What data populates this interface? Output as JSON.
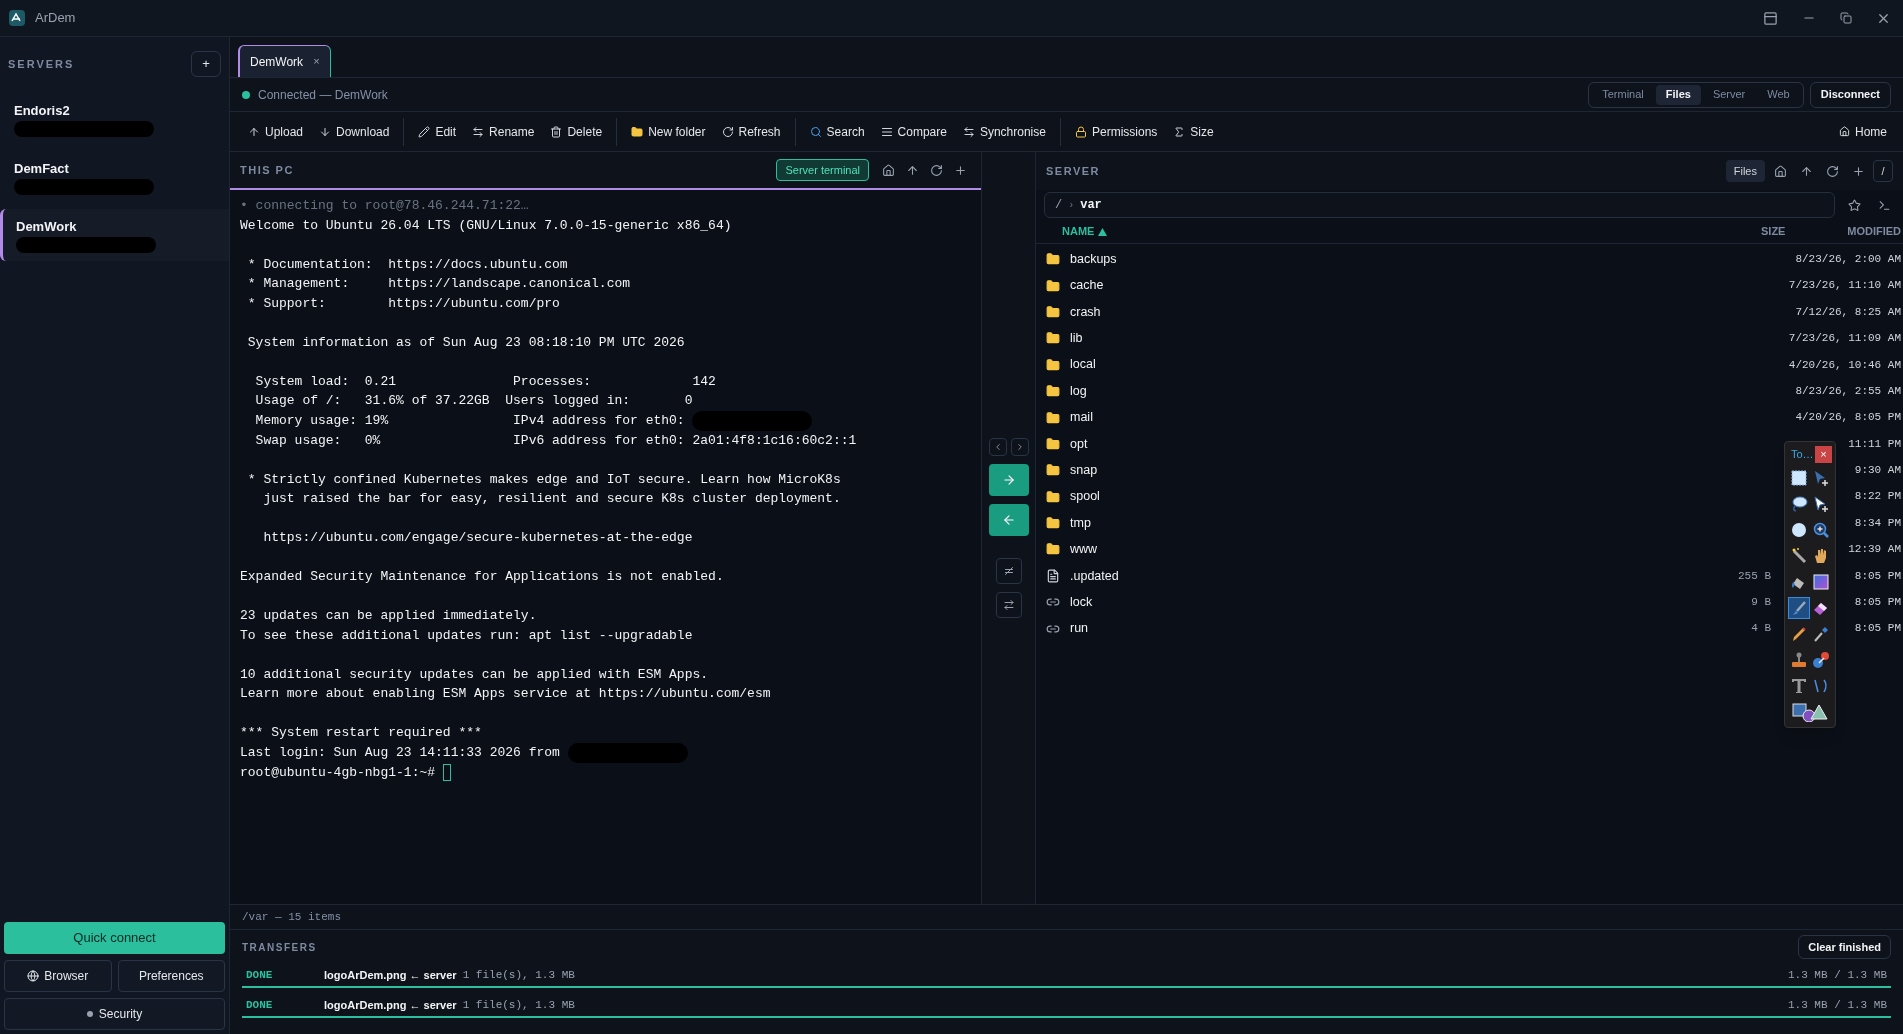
{
  "window": {
    "title": "ArDem"
  },
  "sidebar": {
    "heading": "SERVERS",
    "add": "+",
    "servers": [
      {
        "name": "Endoris2",
        "selected": false,
        "address_redacted": true
      },
      {
        "name": "DemFact",
        "selected": false,
        "address_redacted": true
      },
      {
        "name": "DemWork",
        "selected": true,
        "address_redacted": true
      }
    ],
    "quick_connect": "Quick connect",
    "browser": "Browser",
    "preferences": "Preferences",
    "security": "Security"
  },
  "tabs": [
    {
      "label": "DemWork",
      "close": "×",
      "selected": true
    }
  ],
  "connection": {
    "status": "Connected — DemWork",
    "connected": true
  },
  "views": [
    {
      "label": "Terminal",
      "selected": false
    },
    {
      "label": "Files",
      "selected": true
    },
    {
      "label": "Server",
      "selected": false
    },
    {
      "label": "Web",
      "selected": false
    }
  ],
  "disconnect": "Disconnect",
  "toolbar": {
    "groups": [
      [
        {
          "kind": "upload",
          "label": "Upload"
        },
        {
          "kind": "download",
          "label": "Download"
        }
      ],
      [
        {
          "kind": "edit",
          "label": "Edit"
        },
        {
          "kind": "rename",
          "label": "Rename"
        },
        {
          "kind": "delete",
          "label": "Delete"
        }
      ],
      [
        {
          "kind": "newfolder",
          "label": "New folder"
        },
        {
          "kind": "refresh",
          "label": "Refresh"
        }
      ],
      [
        {
          "kind": "search",
          "label": "Search"
        },
        {
          "kind": "compare",
          "label": "Compare"
        },
        {
          "kind": "sync",
          "label": "Synchronise"
        }
      ],
      [
        {
          "kind": "permissions",
          "label": "Permissions"
        },
        {
          "kind": "size",
          "label": "Size"
        }
      ]
    ],
    "home": "Home"
  },
  "local": {
    "heading": "THIS PC",
    "terminal_button": "Server terminal",
    "terminal": {
      "connecting": "• connecting to root@78.46.244.71:22…",
      "blocks": [
        [
          {
            "text": "Welcome to Ubuntu 26.04 LTS (GNU/Linux 7.0.0-15-generic x86_64)"
          }
        ],
        [
          {
            "text": " * Documentation:  https://docs.ubuntu.com"
          },
          {
            "text": " * Management:     https://landscape.canonical.com"
          },
          {
            "text": " * Support:        https://ubuntu.com/pro"
          }
        ],
        [
          {
            "text": " System information as of Sun Aug 23 08:18:10 PM UTC 2026"
          }
        ],
        [
          {
            "text": "  System load:  0.21               Processes:             142"
          },
          {
            "text": "  Usage of /:   31.6% of 37.22GB  Users logged in:       0"
          },
          {
            "text": "  Memory usage: 19%                IPv4 address for eth0: ",
            "redacted": true
          },
          {
            "text": "  Swap usage:   0%                 IPv6 address for eth0: 2a01:4f8:1c16:60c2::1"
          }
        ],
        [
          {
            "text": " * Strictly confined Kubernetes makes edge and IoT secure. Learn how MicroK8s"
          },
          {
            "text": "   just raised the bar for easy, resilient and secure K8s cluster deployment."
          }
        ],
        [
          {
            "text": "   https://ubuntu.com/engage/secure-kubernetes-at-the-edge"
          }
        ],
        [
          {
            "text": "Expanded Security Maintenance for Applications is not enabled."
          }
        ],
        [
          {
            "text": "23 updates can be applied immediately."
          },
          {
            "text": "To see these additional updates run: apt list --upgradable"
          }
        ],
        [
          {
            "text": "10 additional security updates can be applied with ESM Apps."
          },
          {
            "text": "Learn more about enabling ESM Apps service at https://ubuntu.com/esm"
          }
        ],
        [
          {
            "text": "*** System restart required ***"
          },
          {
            "text": "Last login: Sun Aug 23 14:11:33 2026 from ",
            "redacted": true
          },
          {
            "text": "root@ubuntu-4gb-nbg1-1:~# ",
            "cursor": true
          }
        ]
      ]
    }
  },
  "remote": {
    "heading": "SERVER",
    "files_button": "Files",
    "root_button": "/",
    "path": {
      "root": "/",
      "separator": "›",
      "current": "var"
    },
    "columns": {
      "name": "NAME",
      "size": "SIZE",
      "modified": "MODIFIED"
    },
    "rows": [
      {
        "name": "backups",
        "kind": "folder",
        "modified": "8/23/26, 2:00 AM"
      },
      {
        "name": "cache",
        "kind": "folder",
        "modified": "7/23/26, 11:10 AM"
      },
      {
        "name": "crash",
        "kind": "folder",
        "modified": "7/12/26, 8:25 AM"
      },
      {
        "name": "lib",
        "kind": "folder",
        "modified": "7/23/26, 11:09 AM"
      },
      {
        "name": "local",
        "kind": "folder",
        "modified": "4/20/26, 10:46 AM"
      },
      {
        "name": "log",
        "kind": "folder",
        "modified": "8/23/26, 2:55 AM"
      },
      {
        "name": "mail",
        "kind": "folder",
        "modified": "4/20/26, 8:05 PM"
      },
      {
        "name": "opt",
        "kind": "folder",
        "modified": "11:11 PM"
      },
      {
        "name": "snap",
        "kind": "folder",
        "modified": "9:30 AM"
      },
      {
        "name": "spool",
        "kind": "folder",
        "modified": "8:22 PM"
      },
      {
        "name": "tmp",
        "kind": "folder",
        "modified": "8:34 PM"
      },
      {
        "name": "www",
        "kind": "folder",
        "modified": "12:39 AM"
      },
      {
        "name": ".updated",
        "kind": "file",
        "size": "255 B",
        "modified": "8:05 PM"
      },
      {
        "name": "lock",
        "kind": "link",
        "size": "9 B",
        "modified": "8:05 PM"
      },
      {
        "name": "run",
        "kind": "link",
        "size": "4 B",
        "modified": "8:05 PM"
      }
    ]
  },
  "status_bar": "/var — 15 items",
  "transfers": {
    "heading": "TRANSFERS",
    "clear": "Clear finished",
    "items": [
      {
        "status": "DONE",
        "name": "logoArDem.png ← server",
        "detail": "1 file(s), 1.3 MB",
        "progress": "1.3 MB / 1.3 MB",
        "level": 1
      },
      {
        "status": "DONE",
        "name": "logoArDem.png ← server",
        "detail": "1 file(s), 1.3 MB",
        "progress": "1.3 MB / 1.3 MB",
        "level": 1
      }
    ]
  },
  "tool_palette": {
    "title": "To…",
    "close": "×",
    "tools": [
      {
        "kind": "rect-select",
        "selected": false
      },
      {
        "kind": "move",
        "selected": false
      },
      {
        "kind": "lasso",
        "selected": false
      },
      {
        "kind": "move-selection",
        "selected": false
      },
      {
        "kind": "ellipse",
        "selected": false
      },
      {
        "kind": "zoom",
        "selected": false
      },
      {
        "kind": "wand",
        "selected": false
      },
      {
        "kind": "hand",
        "selected": false
      },
      {
        "kind": "bucket",
        "selected": false
      },
      {
        "kind": "gradient",
        "selected": false
      },
      {
        "kind": "brush",
        "selected": true
      },
      {
        "kind": "eraser",
        "selected": false
      },
      {
        "kind": "pencil",
        "selected": false
      },
      {
        "kind": "dropper",
        "selected": false
      },
      {
        "kind": "stamp",
        "selected": false
      },
      {
        "kind": "recolor",
        "selected": false
      },
      {
        "kind": "text",
        "selected": false
      },
      {
        "kind": "line",
        "selected": false
      },
      {
        "kind": "shapes",
        "selected": false
      }
    ]
  }
}
